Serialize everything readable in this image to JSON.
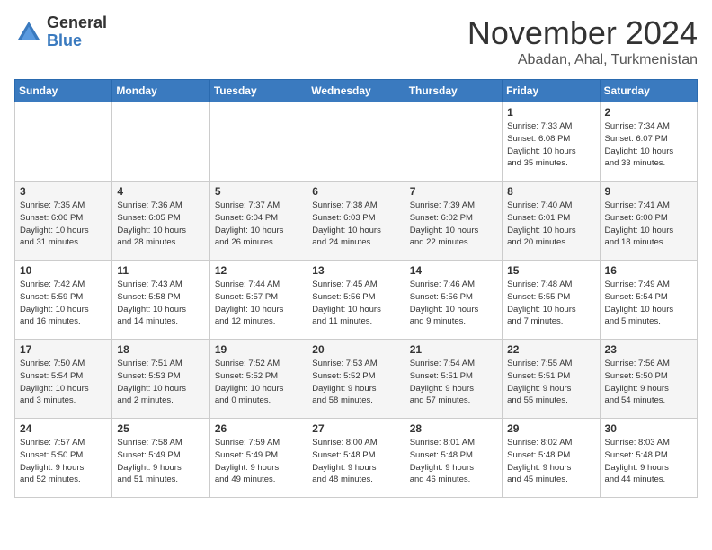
{
  "logo": {
    "general": "General",
    "blue": "Blue"
  },
  "header": {
    "month": "November 2024",
    "location": "Abadan, Ahal, Turkmenistan"
  },
  "weekdays": [
    "Sunday",
    "Monday",
    "Tuesday",
    "Wednesday",
    "Thursday",
    "Friday",
    "Saturday"
  ],
  "weeks": [
    [
      {
        "day": "",
        "info": ""
      },
      {
        "day": "",
        "info": ""
      },
      {
        "day": "",
        "info": ""
      },
      {
        "day": "",
        "info": ""
      },
      {
        "day": "",
        "info": ""
      },
      {
        "day": "1",
        "info": "Sunrise: 7:33 AM\nSunset: 6:08 PM\nDaylight: 10 hours\nand 35 minutes."
      },
      {
        "day": "2",
        "info": "Sunrise: 7:34 AM\nSunset: 6:07 PM\nDaylight: 10 hours\nand 33 minutes."
      }
    ],
    [
      {
        "day": "3",
        "info": "Sunrise: 7:35 AM\nSunset: 6:06 PM\nDaylight: 10 hours\nand 31 minutes."
      },
      {
        "day": "4",
        "info": "Sunrise: 7:36 AM\nSunset: 6:05 PM\nDaylight: 10 hours\nand 28 minutes."
      },
      {
        "day": "5",
        "info": "Sunrise: 7:37 AM\nSunset: 6:04 PM\nDaylight: 10 hours\nand 26 minutes."
      },
      {
        "day": "6",
        "info": "Sunrise: 7:38 AM\nSunset: 6:03 PM\nDaylight: 10 hours\nand 24 minutes."
      },
      {
        "day": "7",
        "info": "Sunrise: 7:39 AM\nSunset: 6:02 PM\nDaylight: 10 hours\nand 22 minutes."
      },
      {
        "day": "8",
        "info": "Sunrise: 7:40 AM\nSunset: 6:01 PM\nDaylight: 10 hours\nand 20 minutes."
      },
      {
        "day": "9",
        "info": "Sunrise: 7:41 AM\nSunset: 6:00 PM\nDaylight: 10 hours\nand 18 minutes."
      }
    ],
    [
      {
        "day": "10",
        "info": "Sunrise: 7:42 AM\nSunset: 5:59 PM\nDaylight: 10 hours\nand 16 minutes."
      },
      {
        "day": "11",
        "info": "Sunrise: 7:43 AM\nSunset: 5:58 PM\nDaylight: 10 hours\nand 14 minutes."
      },
      {
        "day": "12",
        "info": "Sunrise: 7:44 AM\nSunset: 5:57 PM\nDaylight: 10 hours\nand 12 minutes."
      },
      {
        "day": "13",
        "info": "Sunrise: 7:45 AM\nSunset: 5:56 PM\nDaylight: 10 hours\nand 11 minutes."
      },
      {
        "day": "14",
        "info": "Sunrise: 7:46 AM\nSunset: 5:56 PM\nDaylight: 10 hours\nand 9 minutes."
      },
      {
        "day": "15",
        "info": "Sunrise: 7:48 AM\nSunset: 5:55 PM\nDaylight: 10 hours\nand 7 minutes."
      },
      {
        "day": "16",
        "info": "Sunrise: 7:49 AM\nSunset: 5:54 PM\nDaylight: 10 hours\nand 5 minutes."
      }
    ],
    [
      {
        "day": "17",
        "info": "Sunrise: 7:50 AM\nSunset: 5:54 PM\nDaylight: 10 hours\nand 3 minutes."
      },
      {
        "day": "18",
        "info": "Sunrise: 7:51 AM\nSunset: 5:53 PM\nDaylight: 10 hours\nand 2 minutes."
      },
      {
        "day": "19",
        "info": "Sunrise: 7:52 AM\nSunset: 5:52 PM\nDaylight: 10 hours\nand 0 minutes."
      },
      {
        "day": "20",
        "info": "Sunrise: 7:53 AM\nSunset: 5:52 PM\nDaylight: 9 hours\nand 58 minutes."
      },
      {
        "day": "21",
        "info": "Sunrise: 7:54 AM\nSunset: 5:51 PM\nDaylight: 9 hours\nand 57 minutes."
      },
      {
        "day": "22",
        "info": "Sunrise: 7:55 AM\nSunset: 5:51 PM\nDaylight: 9 hours\nand 55 minutes."
      },
      {
        "day": "23",
        "info": "Sunrise: 7:56 AM\nSunset: 5:50 PM\nDaylight: 9 hours\nand 54 minutes."
      }
    ],
    [
      {
        "day": "24",
        "info": "Sunrise: 7:57 AM\nSunset: 5:50 PM\nDaylight: 9 hours\nand 52 minutes."
      },
      {
        "day": "25",
        "info": "Sunrise: 7:58 AM\nSunset: 5:49 PM\nDaylight: 9 hours\nand 51 minutes."
      },
      {
        "day": "26",
        "info": "Sunrise: 7:59 AM\nSunset: 5:49 PM\nDaylight: 9 hours\nand 49 minutes."
      },
      {
        "day": "27",
        "info": "Sunrise: 8:00 AM\nSunset: 5:48 PM\nDaylight: 9 hours\nand 48 minutes."
      },
      {
        "day": "28",
        "info": "Sunrise: 8:01 AM\nSunset: 5:48 PM\nDaylight: 9 hours\nand 46 minutes."
      },
      {
        "day": "29",
        "info": "Sunrise: 8:02 AM\nSunset: 5:48 PM\nDaylight: 9 hours\nand 45 minutes."
      },
      {
        "day": "30",
        "info": "Sunrise: 8:03 AM\nSunset: 5:48 PM\nDaylight: 9 hours\nand 44 minutes."
      }
    ]
  ]
}
